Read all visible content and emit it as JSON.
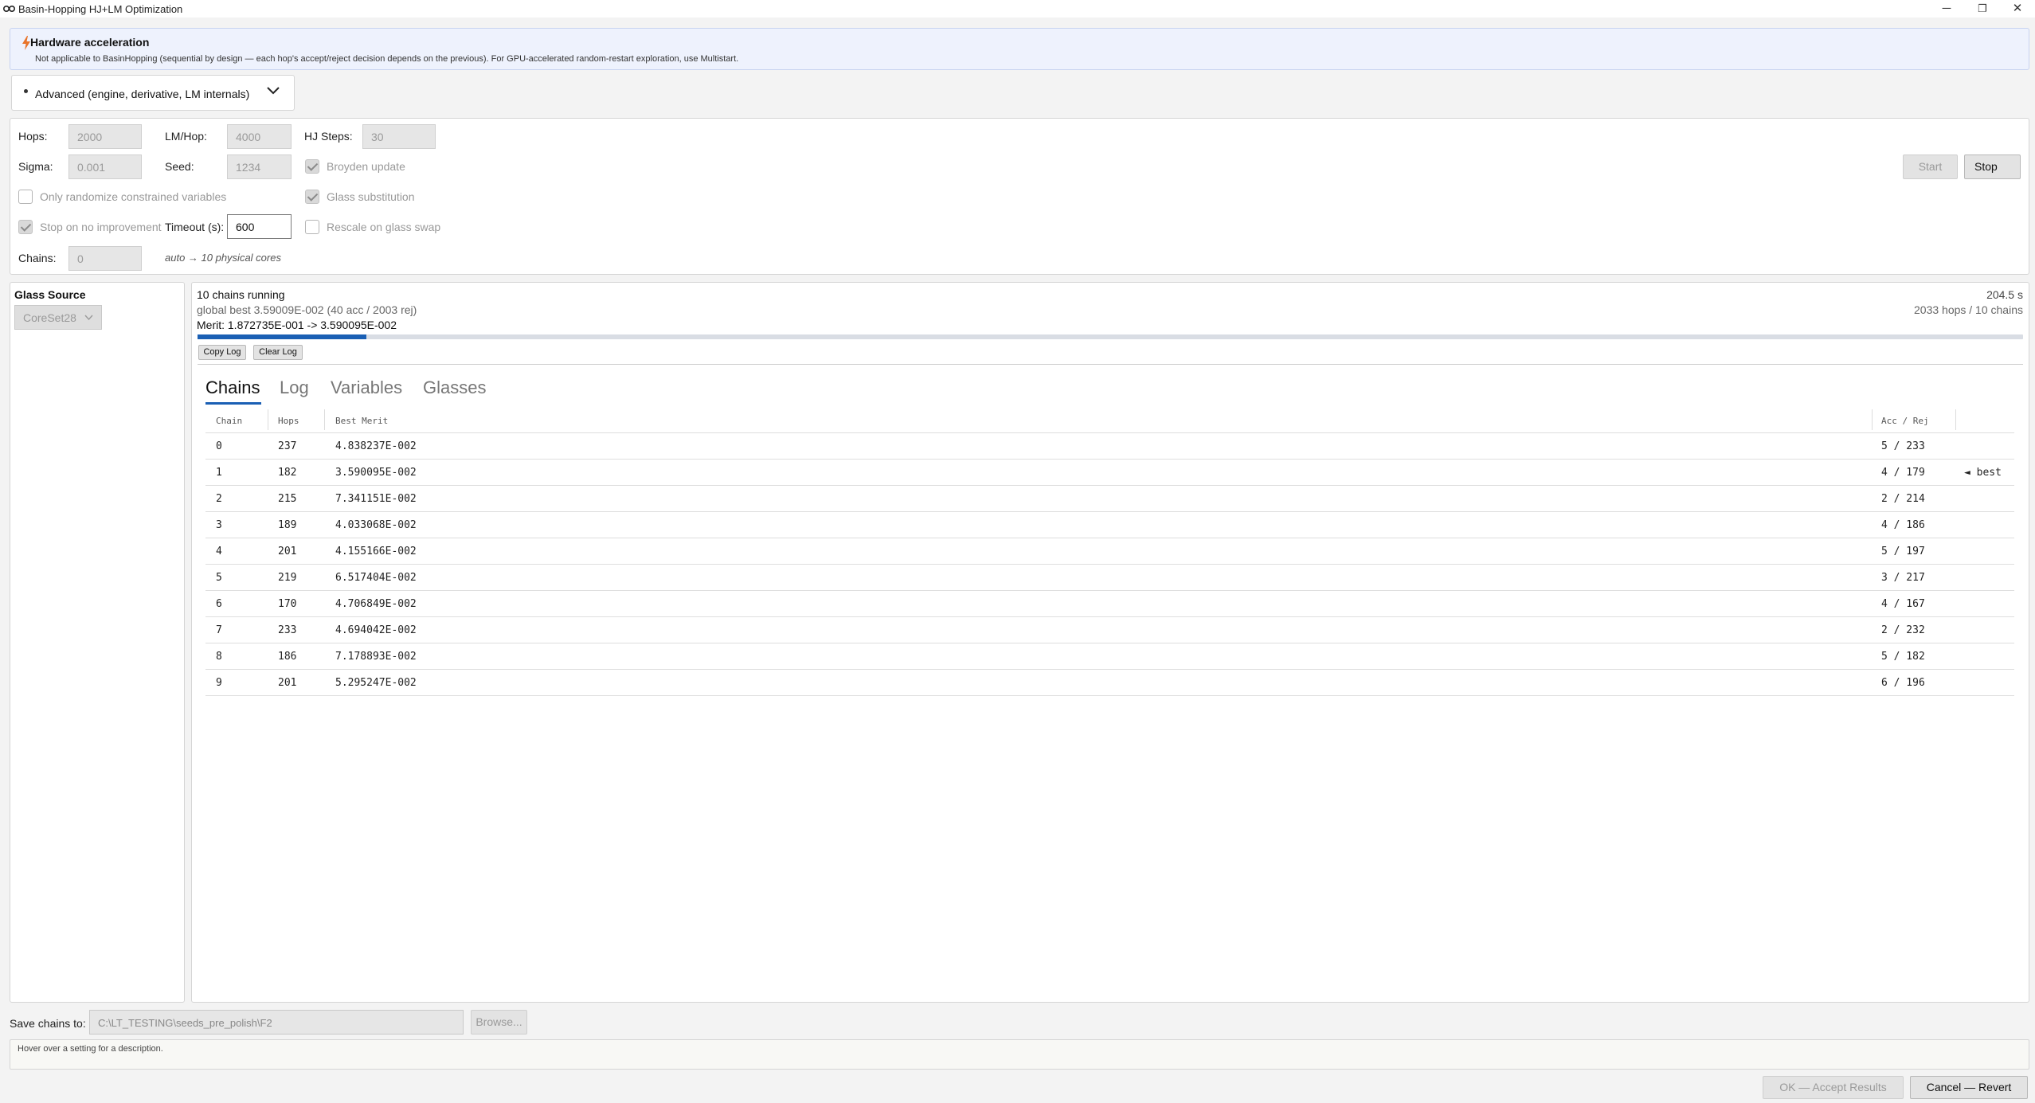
{
  "window": {
    "title": "Basin-Hopping HJ+LM Optimization",
    "controls": {
      "minimize": "─",
      "maximize": "❐",
      "close": "✕"
    }
  },
  "banner": {
    "title": "Hardware acceleration",
    "text": "Not applicable to BasinHopping (sequential by design — each hop's accept/reject decision depends on the previous). For GPU-accelerated random-restart exploration, use Multistart."
  },
  "advanced": {
    "label": "Advanced (engine, derivative, LM internals)"
  },
  "settings": {
    "hops_label": "Hops:",
    "hops_value": "2000",
    "lmhop_label": "LM/Hop:",
    "lmhop_value": "4000",
    "hjsteps_label": "HJ Steps:",
    "hjsteps_value": "30",
    "sigma_label": "Sigma:",
    "sigma_value": "0.001",
    "seed_label": "Seed:",
    "seed_value": "1234",
    "broyden_label": "Broyden update",
    "broyden_checked": true,
    "only_randomize_label": "Only randomize constrained variables",
    "only_randomize_checked": false,
    "glass_sub_label": "Glass substitution",
    "glass_sub_checked": true,
    "stop_no_improve_label": "Stop on no improvement",
    "stop_no_improve_checked": true,
    "timeout_label": "Timeout (s):",
    "timeout_value": "600",
    "rescale_label": "Rescale on glass swap",
    "rescale_checked": false,
    "chains_label": "Chains:",
    "chains_value": "0",
    "chains_hint": "auto → 10 physical cores",
    "start_label": "Start",
    "stop_label": "Stop"
  },
  "glass": {
    "title": "Glass Source",
    "selected": "CoreSet28"
  },
  "status": {
    "main": "10 chains running",
    "global_best": "global best 3.59009E-002   (40 acc / 2003 rej)",
    "merit": "Merit: 1.872735E-001 -> 3.590095E-002",
    "elapsed": "204.5 s",
    "hops_summary": "2033 hops / 10 chains",
    "progress_fraction": 0.0925
  },
  "log_buttons": {
    "copy": "Copy Log",
    "clear": "Clear Log"
  },
  "tabs": [
    "Chains",
    "Log",
    "Variables",
    "Glasses"
  ],
  "active_tab": "Chains",
  "table": {
    "headers": [
      "Chain",
      "Hops",
      "Best Merit",
      "Acc / Rej"
    ],
    "rows": [
      {
        "chain": "0",
        "hops": "237",
        "merit": "4.838237E-002",
        "accrej": "5 / 233",
        "note": ""
      },
      {
        "chain": "1",
        "hops": "182",
        "merit": "3.590095E-002",
        "accrej": "4 / 179",
        "note": "◄ best"
      },
      {
        "chain": "2",
        "hops": "215",
        "merit": "7.341151E-002",
        "accrej": "2 / 214",
        "note": ""
      },
      {
        "chain": "3",
        "hops": "189",
        "merit": "4.033068E-002",
        "accrej": "4 / 186",
        "note": ""
      },
      {
        "chain": "4",
        "hops": "201",
        "merit": "4.155166E-002",
        "accrej": "5 / 197",
        "note": ""
      },
      {
        "chain": "5",
        "hops": "219",
        "merit": "6.517404E-002",
        "accrej": "3 / 217",
        "note": ""
      },
      {
        "chain": "6",
        "hops": "170",
        "merit": "4.706849E-002",
        "accrej": "4 / 167",
        "note": ""
      },
      {
        "chain": "7",
        "hops": "233",
        "merit": "4.694042E-002",
        "accrej": "2 / 232",
        "note": ""
      },
      {
        "chain": "8",
        "hops": "186",
        "merit": "7.178893E-002",
        "accrej": "5 / 182",
        "note": ""
      },
      {
        "chain": "9",
        "hops": "201",
        "merit": "5.295247E-002",
        "accrej": "6 / 196",
        "note": ""
      }
    ]
  },
  "save": {
    "label": "Save chains to:",
    "path": "C:\\LT_TESTING\\seeds_pre_polish\\F2",
    "browse": "Browse..."
  },
  "hint": {
    "text": "Hover over a setting for a description."
  },
  "footer": {
    "ok": "OK — Accept Results",
    "cancel": "Cancel — Revert"
  },
  "colors": {
    "accent": "#1a5fb4",
    "bolt": "#e8742a",
    "banner_bg": "#eef2fd"
  }
}
